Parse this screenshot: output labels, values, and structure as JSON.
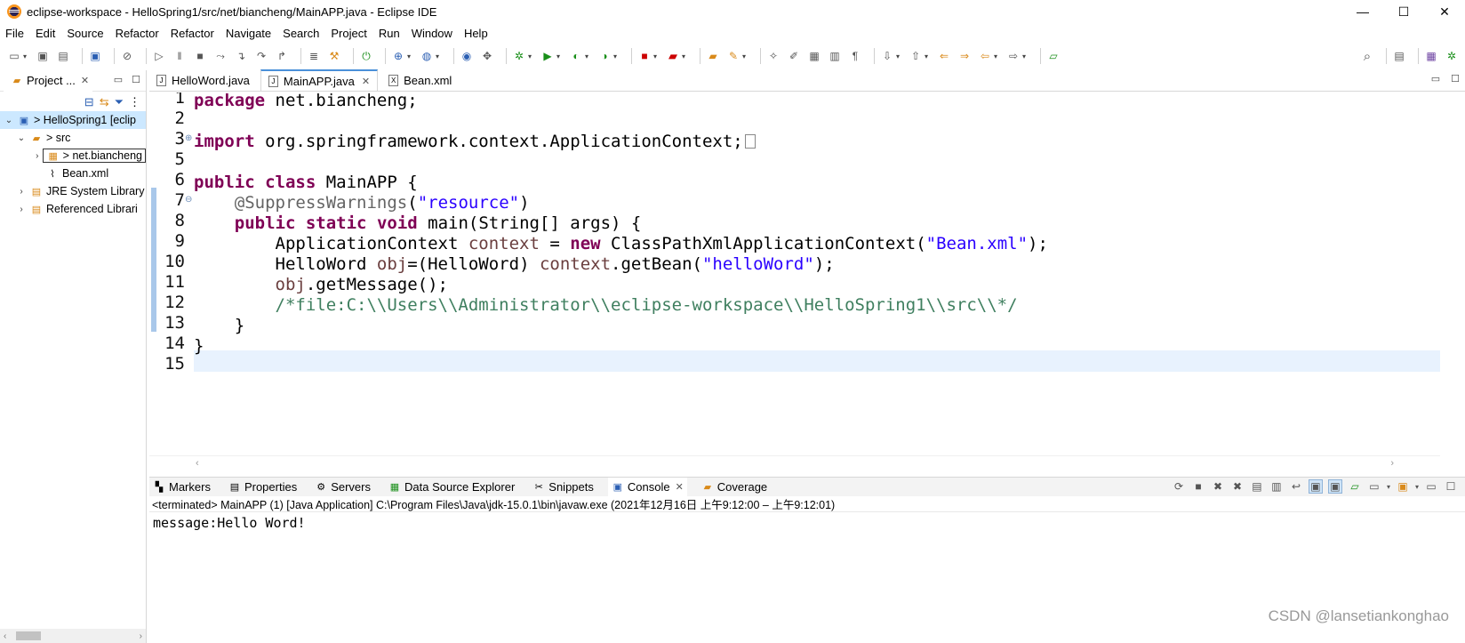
{
  "window": {
    "title": "eclipse-workspace - HelloSpring1/src/net/biancheng/MainAPP.java - Eclipse IDE",
    "controls": [
      "—",
      "☐",
      "✕"
    ]
  },
  "menu": [
    "File",
    "Edit",
    "Source",
    "Refactor",
    "Refactor",
    "Navigate",
    "Search",
    "Project",
    "Run",
    "Window",
    "Help"
  ],
  "project_explorer": {
    "tab_label": "Project ...",
    "tree": [
      {
        "label": "> HelloSpring1 [eclip",
        "level": 0,
        "expanded": true,
        "selected": true
      },
      {
        "label": "> src",
        "level": 1,
        "expanded": true
      },
      {
        "label": "> net.biancheng",
        "level": 2,
        "expanded": false
      },
      {
        "label": "Bean.xml",
        "level": 2
      },
      {
        "label": "JRE System Library",
        "level": 1,
        "expanded": false
      },
      {
        "label": "Referenced Librari",
        "level": 1,
        "expanded": false
      }
    ]
  },
  "editor": {
    "tabs": [
      {
        "label": "HelloWord.java",
        "active": false,
        "closable": false
      },
      {
        "label": "MainAPP.java",
        "active": true,
        "closable": true
      },
      {
        "label": "Bean.xml",
        "active": false,
        "closable": false
      }
    ],
    "line_numbers": [
      "1",
      "2",
      "3",
      "5",
      "6",
      "7",
      "8",
      "9",
      "10",
      "11",
      "12",
      "13",
      "14",
      "15"
    ],
    "current_line": "15",
    "code": {
      "l1_kw": "package",
      "l1_rest": " net.biancheng;",
      "l3_kw": "import",
      "l3_rest": " org.springframework.context.ApplicationContext;",
      "l6_kw1": "public",
      "l6_kw2": "class",
      "l6_rest": " MainAPP {",
      "l7_ann": "@SuppressWarnings",
      "l7_open": "(",
      "l7_str": "\"resource\"",
      "l7_close": ")",
      "l8_kw1": "public",
      "l8_kw2": "static",
      "l8_kw3": "void",
      "l8_rest": " main(String[] args) {",
      "l9_a": "ApplicationContext ",
      "l9_var": "context",
      "l9_b": " = ",
      "l9_kw": "new",
      "l9_c": " ClassPathXmlApplicationContext(",
      "l9_str": "\"Bean.xml\"",
      "l9_d": ");",
      "l10_a": "HelloWord ",
      "l10_var": "obj",
      "l10_b": "=(HelloWord) ",
      "l10_var2": "context",
      "l10_c": ".getBean(",
      "l10_str": "\"helloWord\"",
      "l10_d": ");",
      "l11_var": "obj",
      "l11_rest": ".getMessage();",
      "l12_cm": "/*file:C:\\\\Users\\\\Administrator\\\\eclipse-workspace\\\\HelloSpring1\\\\src\\\\*/",
      "l13": "}",
      "l14": "}"
    }
  },
  "bottom_panel": {
    "tabs": [
      {
        "label": "Markers",
        "icon": "markers-icon"
      },
      {
        "label": "Properties",
        "icon": "properties-icon"
      },
      {
        "label": "Servers",
        "icon": "servers-icon"
      },
      {
        "label": "Data Source Explorer",
        "icon": "data-source-icon"
      },
      {
        "label": "Snippets",
        "icon": "snippets-icon"
      },
      {
        "label": "Console",
        "icon": "console-icon",
        "active": true
      },
      {
        "label": "Coverage",
        "icon": "coverage-icon"
      }
    ],
    "console_status": "<terminated> MainAPP (1) [Java Application] C:\\Program Files\\Java\\jdk-15.0.1\\bin\\javaw.exe  (2021年12月16日 上午9:12:00 – 上午9:12:01)",
    "console_output": "message:Hello Word!"
  },
  "watermark": "CSDN @lansetiankonghao",
  "colors": {
    "keyword": "#7f0055",
    "string": "#2a00ff",
    "comment": "#3f7f5f",
    "annotation": "#646464",
    "field": "#6a3e3e",
    "current_line": "#e8f2fe",
    "selection": "#cce8ff"
  }
}
